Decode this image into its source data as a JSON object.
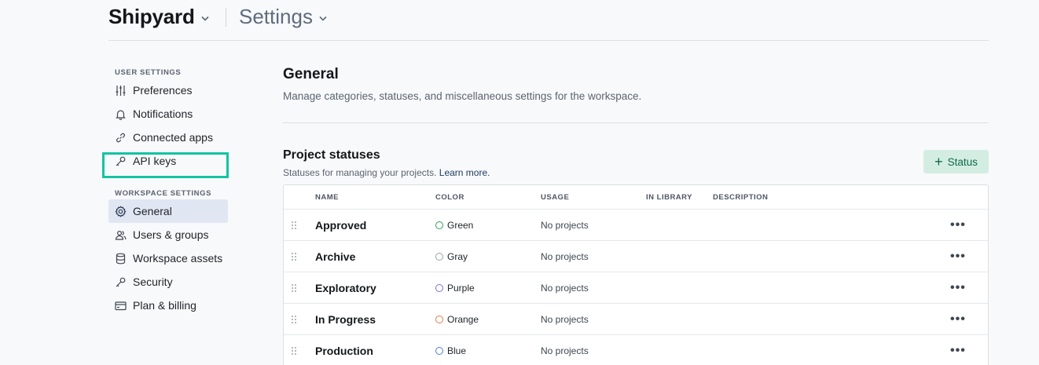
{
  "header": {
    "workspace": "Shipyard",
    "page": "Settings"
  },
  "sidebar": {
    "user_section": "USER SETTINGS",
    "user_items": [
      {
        "label": "Preferences",
        "icon": "sliders-icon"
      },
      {
        "label": "Notifications",
        "icon": "bell-icon"
      },
      {
        "label": "Connected apps",
        "icon": "link-icon"
      },
      {
        "label": "API keys",
        "icon": "key-icon"
      }
    ],
    "workspace_section": "WORKSPACE SETTINGS",
    "workspace_items": [
      {
        "label": "General",
        "icon": "gear-icon",
        "active": true
      },
      {
        "label": "Users & groups",
        "icon": "users-icon"
      },
      {
        "label": "Workspace assets",
        "icon": "database-icon"
      },
      {
        "label": "Security",
        "icon": "key-icon"
      },
      {
        "label": "Plan & billing",
        "icon": "credit-card-icon"
      }
    ]
  },
  "main": {
    "title": "General",
    "subtitle": "Manage categories, statuses, and miscellaneous settings for the workspace.",
    "section": {
      "title": "Project statuses",
      "subtitle": "Statuses for managing your projects.",
      "learn_more": "Learn more.",
      "add_button": "Status"
    },
    "table": {
      "columns": [
        "NAME",
        "COLOR",
        "USAGE",
        "IN LIBRARY",
        "DESCRIPTION"
      ],
      "rows": [
        {
          "name": "Approved",
          "color": "Green",
          "color_hex": "#2e9e5b",
          "usage": "No projects"
        },
        {
          "name": "Archive",
          "color": "Gray",
          "color_hex": "#9aa1aa",
          "usage": "No projects"
        },
        {
          "name": "Exploratory",
          "color": "Purple",
          "color_hex": "#7b6fcf",
          "usage": "No projects"
        },
        {
          "name": "In Progress",
          "color": "Orange",
          "color_hex": "#e0784a",
          "usage": "No projects"
        },
        {
          "name": "Production",
          "color": "Blue",
          "color_hex": "#4a7fd6",
          "usage": "No projects"
        }
      ]
    }
  },
  "accent": {
    "highlight": "#13c4a3",
    "active_bg": "#e1e6f3",
    "button_bg": "#d4ede2"
  }
}
